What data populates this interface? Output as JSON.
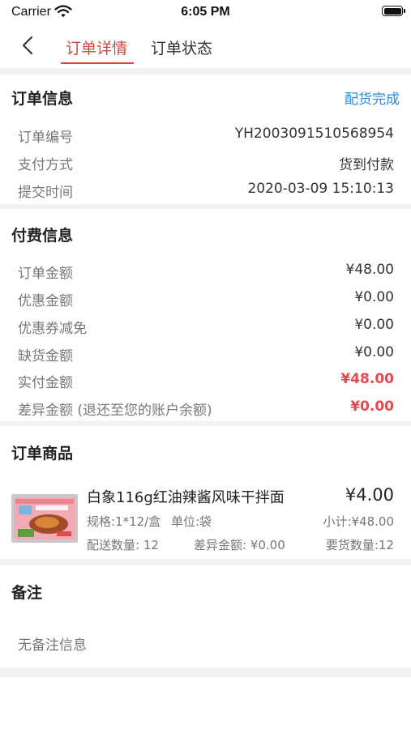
{
  "status_bar": {
    "carrier": "Carrier",
    "time": "6:05 PM"
  },
  "nav": {
    "tab_detail": "订单详情",
    "tab_status": "订单状态"
  },
  "order_info": {
    "title": "订单信息",
    "status": "配货完成",
    "rows": [
      {
        "label": "订单编号",
        "value": "YH2003091510568954"
      },
      {
        "label": "支付方式",
        "value": "货到付款"
      },
      {
        "label": "提交时间",
        "value": "2020-03-09 15:10:13"
      }
    ]
  },
  "payment": {
    "title": "付费信息",
    "rows": [
      {
        "label": "订单金额",
        "value": "¥48.00"
      },
      {
        "label": "优惠金额",
        "value": "¥0.00"
      },
      {
        "label": "优惠券减免",
        "value": "¥0.00"
      },
      {
        "label": "缺货金额",
        "value": "¥0.00"
      },
      {
        "label": "实付金额",
        "value": "¥48.00"
      },
      {
        "label": "差异金额 (退还至您的账户余额)",
        "value": "¥0.00"
      }
    ]
  },
  "goods": {
    "title": "订单商品",
    "item": {
      "name": "白象116g红油辣酱风味干拌面",
      "price": "¥4.00",
      "spec": "规格:1*12/盒",
      "unit": "单位:袋",
      "subtotal": "小计:¥48.00",
      "delivered_qty": "配送数量: 12",
      "diff_amount": "差异金额: ¥0.00",
      "required_qty": "要货数量:12"
    }
  },
  "remark": {
    "title": "备注",
    "text": "无备注信息"
  },
  "colors": {
    "accent": "#d8443a",
    "link": "#2a8ad8",
    "highlight": "#e5484d"
  }
}
